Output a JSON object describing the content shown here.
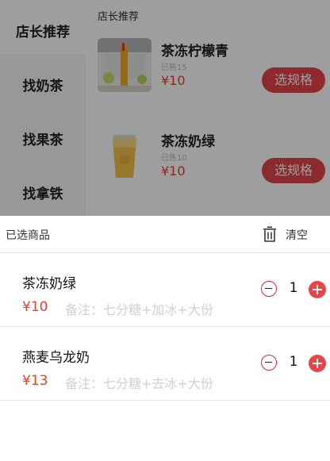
{
  "sidebar": {
    "items": [
      {
        "label": "店长推荐"
      },
      {
        "label": "找奶茶"
      },
      {
        "label": "找果茶"
      },
      {
        "label": "找拿铁"
      }
    ]
  },
  "section_title": "店长推荐",
  "products": [
    {
      "name": "茶冻柠檬青",
      "sold": "已售15",
      "price": "¥10",
      "button": "选规格"
    },
    {
      "name": "茶冻奶绿",
      "sold": "已售10",
      "price": "¥10",
      "button": "选规格"
    }
  ],
  "cart": {
    "title": "已选商品",
    "clear_label": "清空",
    "items": [
      {
        "name": "茶冻奶绿",
        "price": "¥10",
        "note": "备注：七分糖+加冰+大份",
        "qty": "1"
      },
      {
        "name": "燕麦乌龙奶",
        "price": "¥13",
        "note": "备注：七分糖+去冰+大份",
        "qty": "1"
      }
    ]
  },
  "colors": {
    "accent": "#e0464b",
    "price": "#e8412e",
    "overlay": "rgba(0,0,0,0.38)"
  }
}
